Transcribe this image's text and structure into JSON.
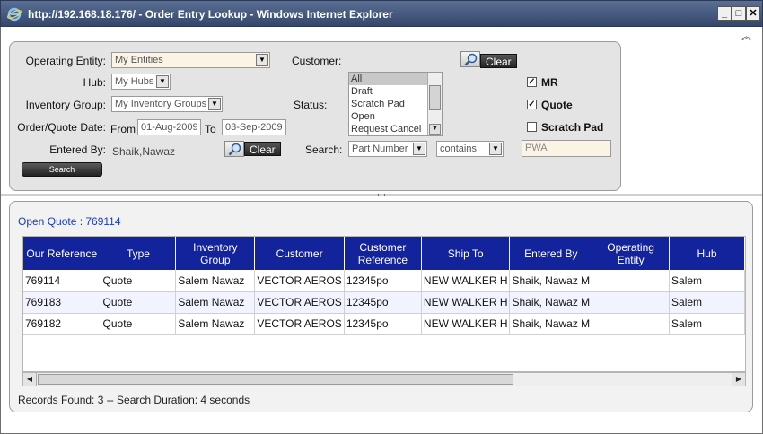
{
  "window": {
    "title": "http://192.168.18.176/ - Order Entry Lookup - Windows Internet Explorer",
    "minimize": "_",
    "maximize": "□",
    "close": "✕"
  },
  "search": {
    "operating_entity_label": "Operating Entity:",
    "operating_entity_value": "My Entities",
    "hub_label": "Hub:",
    "hub_value": "My Hubs",
    "inventory_group_label": "Inventory Group:",
    "inventory_group_value": "My Inventory Groups",
    "date_label": "Order/Quote Date:",
    "from_label": "From",
    "from_value": "01-Aug-2009",
    "to_label": "To",
    "to_value": "03-Sep-2009",
    "entered_by_label": "Entered By:",
    "entered_by_value": "Shaik,Nawaz",
    "clear_label": "Clear",
    "search_button": "Search",
    "customer_label": "Customer:",
    "status_label": "Status:",
    "status_options": [
      "All",
      "Draft",
      "Scratch Pad",
      "Open",
      "Request Cancel"
    ],
    "search_label": "Search:",
    "search_field_value": "Part Number",
    "search_op_value": "contains",
    "search_text_value": "PWA",
    "chk_mr_label": "MR",
    "chk_quote_label": "Quote",
    "chk_scratch_label": "Scratch Pad",
    "chk_mr_checked": true,
    "chk_quote_checked": true,
    "chk_scratch_checked": false
  },
  "results": {
    "open_quote": "Open Quote : 769114",
    "columns": [
      "Our Reference",
      "Type",
      "Inventory Group",
      "Customer",
      "Customer Reference",
      "Ship To",
      "Entered By",
      "Operating Entity",
      "Hub"
    ],
    "rows": [
      [
        "769114",
        "Quote",
        "Salem Nawaz",
        "VECTOR AEROS",
        "12345po",
        "NEW WALKER H",
        "Shaik, Nawaz M",
        "",
        "Salem"
      ],
      [
        "769183",
        "Quote",
        "Salem Nawaz",
        "VECTOR AEROS",
        "12345po",
        "NEW WALKER H",
        "Shaik, Nawaz M",
        "",
        "Salem"
      ],
      [
        "769182",
        "Quote",
        "Salem Nawaz",
        "VECTOR AEROS",
        "12345po",
        "NEW WALKER H",
        "Shaik, Nawaz M",
        "",
        "Salem"
      ]
    ],
    "records_text": "Records Found: 3 -- Search Duration: 4 seconds"
  },
  "icons": {
    "ie": "ie-logo-icon",
    "lookup": "magnifier-icon",
    "collapse": "chevron-double-up-icon",
    "dropdown": "dropdown-arrow-icon"
  },
  "colors": {
    "header_bg": "#13239c",
    "titlebar": "#34466b",
    "link": "#1a3bb5"
  }
}
